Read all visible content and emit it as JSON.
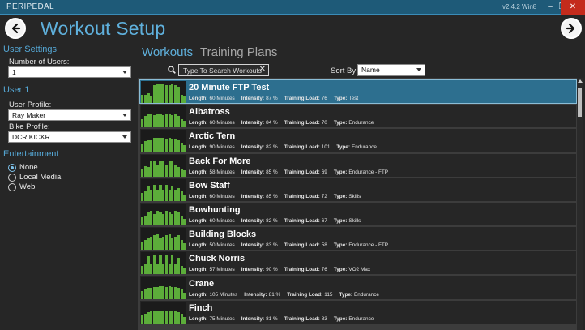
{
  "window": {
    "app_name": "PERIPEDAL",
    "version": "v2.4.2 Win8",
    "minimize": "–",
    "restore": "❐",
    "close": "✕"
  },
  "header": {
    "title": "Workout Setup",
    "back_icon": "arrow-left-icon",
    "forward_icon": "arrow-right-icon"
  },
  "sidebar": {
    "user_settings_heading": "User Settings",
    "num_users_label": "Number of Users:",
    "num_users_value": "1",
    "user1_heading": "User 1",
    "user_profile_label": "User Profile:",
    "user_profile_value": "Ray Maker",
    "bike_profile_label": "Bike Profile:",
    "bike_profile_value": "DCR KICKR",
    "entertainment_heading": "Entertainment",
    "entertainment_options": [
      {
        "label": "None",
        "selected": true
      },
      {
        "label": "Local Media",
        "selected": false
      },
      {
        "label": "Web",
        "selected": false
      }
    ]
  },
  "tabs": {
    "workouts": "Workouts",
    "training_plans": "Training Plans"
  },
  "search": {
    "placeholder": "Type To Search Workouts",
    "clear": "✕"
  },
  "sort": {
    "label": "Sort By:",
    "value": "Name"
  },
  "meta_labels": {
    "length": "Length:",
    "intensity": "Intensity:",
    "training_load": "Training Load:",
    "type": "Type:"
  },
  "workouts": [
    {
      "name": "20 Minute FTP Test",
      "length": "60 Minutes",
      "intensity": "87 %",
      "training_load": "76",
      "type": "Test",
      "selected": true
    },
    {
      "name": "Albatross",
      "length": "60 Minutes",
      "intensity": "84 %",
      "training_load": "70",
      "type": "Endurance",
      "selected": false
    },
    {
      "name": "Arctic Tern",
      "length": "90 Minutes",
      "intensity": "82 %",
      "training_load": "101",
      "type": "Endurance",
      "selected": false
    },
    {
      "name": "Back For More",
      "length": "58 Minutes",
      "intensity": "85 %",
      "training_load": "69",
      "type": "Endurance - FTP",
      "selected": false
    },
    {
      "name": "Bow Staff",
      "length": "60 Minutes",
      "intensity": "85 %",
      "training_load": "72",
      "type": "Skills",
      "selected": false
    },
    {
      "name": "Bowhunting",
      "length": "60 Minutes",
      "intensity": "82 %",
      "training_load": "67",
      "type": "Skills",
      "selected": false
    },
    {
      "name": "Building Blocks",
      "length": "50 Minutes",
      "intensity": "83 %",
      "training_load": "58",
      "type": "Endurance - FTP",
      "selected": false
    },
    {
      "name": "Chuck Norris",
      "length": "57 Minutes",
      "intensity": "90 %",
      "training_load": "76",
      "type": "VO2 Max",
      "selected": false
    },
    {
      "name": "Crane",
      "length": "105 Minutes",
      "intensity": "81 %",
      "training_load": "115",
      "type": "Endurance",
      "selected": false
    },
    {
      "name": "Finch",
      "length": "75 Minutes",
      "intensity": "81 %",
      "training_load": "83",
      "type": "Endurance",
      "selected": false
    }
  ],
  "colors": {
    "accent": "#5fb0dc",
    "titlebar": "#1e5a78",
    "selected_row": "#2d6f8f",
    "profile_bar": "#5cad3a"
  }
}
